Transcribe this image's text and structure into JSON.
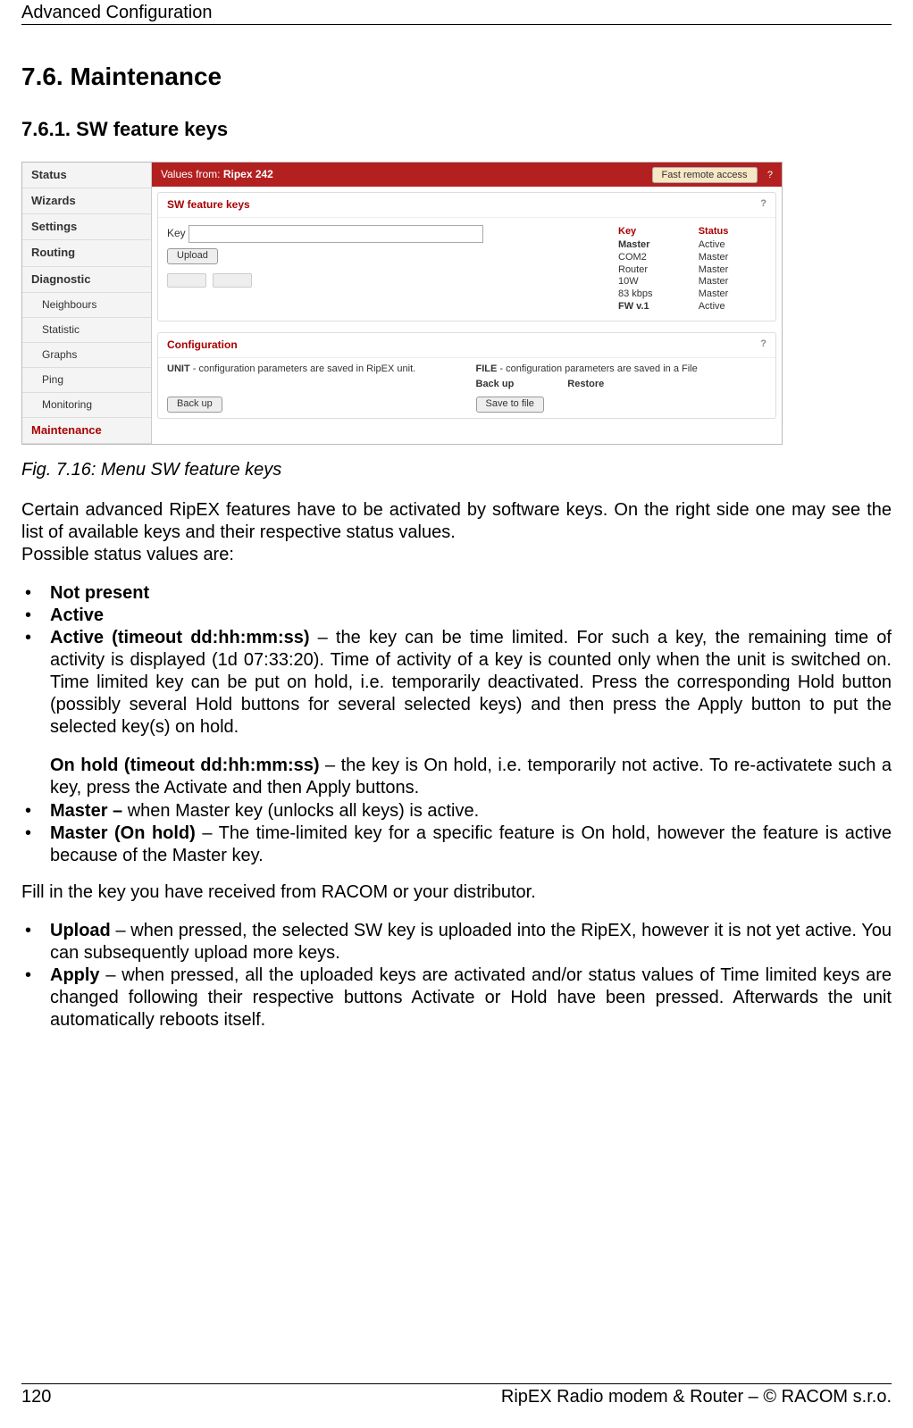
{
  "running_head": "Advanced Configuration",
  "h2": "7.6. Maintenance",
  "h3": "7.6.1. SW feature keys",
  "fig_caption": "Fig. 7.16: Menu SW feature keys",
  "intro1": "Certain advanced RipEX features have to be activated by software keys. On the right side one may see the list of available keys and their respective status values.",
  "intro2": "Possible status values are:",
  "status_list": {
    "not_present": "Not present",
    "active": "Active",
    "active_timeout_label": "Active (timeout dd:hh:mm:ss)",
    "active_timeout_text": " – the key can be time limited. For such a key, the remaining time of activity is displayed (1d 07:33:20). Time of activity of a key is counted only when the unit is switched on. Time limited key can be put on hold, i.e. temporarily deactivated. Press the corresponding Hold button (possibly several Hold buttons for several selected keys) and then press the Apply button to put the selected key(s) on hold.",
    "on_hold_label": "On hold (timeout dd:hh:mm:ss)",
    "on_hold_text": " – the key is On hold, i.e. temporarily not active. To re-activatete such a key, press the Activate and then Apply buttons.",
    "master_label": "Master –",
    "master_text": " when Master key (unlocks all keys) is active.",
    "master_hold_label": "Master (On hold)",
    "master_hold_text": " – The time-limited key for a specific feature is On hold, however the feature is active because of the Master key."
  },
  "fill_line": "Fill in the key you have received from RACOM or your distributor.",
  "action_list": {
    "upload_label": "Upload",
    "upload_text": " – when pressed, the selected SW key is uploaded into the RipEX, however it is not yet active. You can subsequently upload more keys.",
    "apply_label": "Apply",
    "apply_text": " – when pressed, all the uploaded keys are activated and/or status values of Time limited keys are changed following their respective buttons Activate or Hold have been pressed. Afterwards the unit automatically reboots itself."
  },
  "footer": {
    "page": "120",
    "right": "RipEX Radio modem & Router – © RACOM s.r.o."
  },
  "shot": {
    "sidebar": [
      "Status",
      "Wizards",
      "Settings",
      "Routing",
      "Diagnostic",
      "Neighbours",
      "Statistic",
      "Graphs",
      "Ping",
      "Monitoring",
      "Maintenance"
    ],
    "hdr_left_prefix": "Values from:",
    "hdr_left_name": "Ripex 242",
    "hdr_btn": "Fast remote access",
    "hdr_q": "?",
    "card1_title": "SW feature keys",
    "key_label": "Key",
    "upload_btn": "Upload",
    "keys_table": {
      "headers": [
        "Key",
        "Status"
      ],
      "rows": [
        [
          "Master",
          "Active"
        ],
        [
          "COM2",
          "Master"
        ],
        [
          "Router",
          "Master"
        ],
        [
          "10W",
          "Master"
        ],
        [
          "83 kbps",
          "Master"
        ],
        [
          "FW v.1",
          "Active"
        ]
      ]
    },
    "card2_title": "Configuration",
    "unit_label": "UNIT",
    "unit_text": " - configuration parameters are saved in RipEX unit.",
    "file_label": "FILE",
    "file_text": " - configuration parameters are saved in a File",
    "backup_btn": "Back up",
    "backup_hdr": "Back up",
    "restore_hdr": "Restore",
    "save_btn": "Save to file"
  }
}
